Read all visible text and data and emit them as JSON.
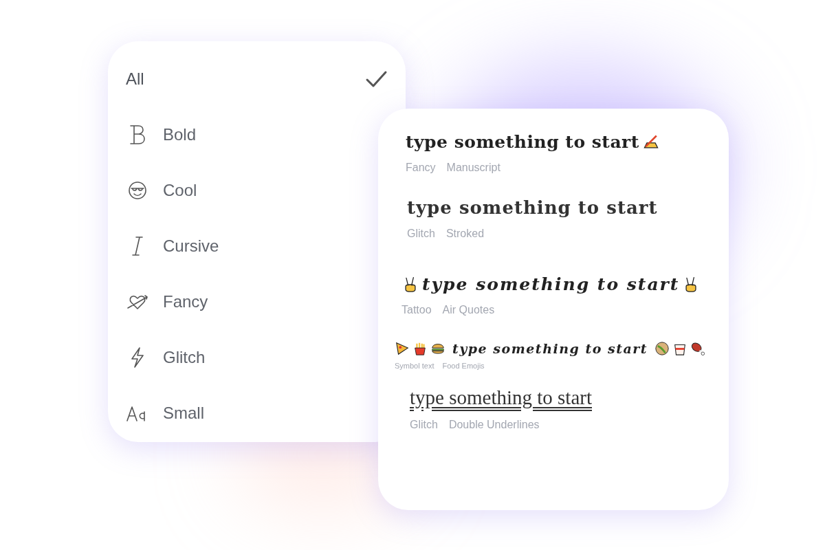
{
  "filter_menu": {
    "items": [
      {
        "label": "All",
        "selected": true
      },
      {
        "label": "Bold",
        "selected": false
      },
      {
        "label": "Cool",
        "selected": false
      },
      {
        "label": "Cursive",
        "selected": false
      },
      {
        "label": "Fancy",
        "selected": false
      },
      {
        "label": "Glitch",
        "selected": false
      },
      {
        "label": "Small",
        "selected": false
      }
    ]
  },
  "results": [
    {
      "kind": "manuscript",
      "text": "type something to start",
      "tags": [
        "Fancy",
        "Manuscript"
      ]
    },
    {
      "kind": "stroked",
      "text": "type something to start",
      "tags": [
        "Glitch",
        "Stroked"
      ]
    },
    {
      "kind": "air-quotes",
      "text": "type something to start",
      "tags": [
        "Tattoo",
        "Air Quotes"
      ]
    },
    {
      "kind": "food-emojis",
      "text": "type something to start",
      "tags": [
        "Symbol text",
        "Food Emojis"
      ]
    },
    {
      "kind": "double-underline",
      "text": "type something to start",
      "tags": [
        "Glitch",
        "Double Underlines"
      ]
    }
  ]
}
